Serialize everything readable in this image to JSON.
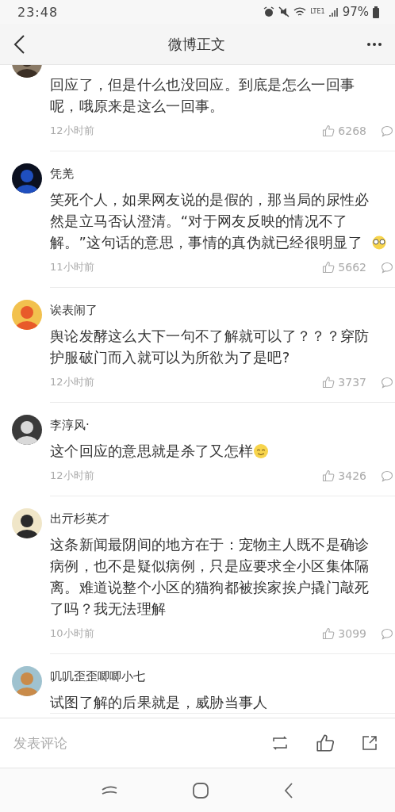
{
  "status_bar": {
    "time": "23:48",
    "network": "LTE1",
    "battery": "97%"
  },
  "header": {
    "title": "微博正文"
  },
  "comments": [
    {
      "text": "回应了，但是什么也没回应。到底是怎么一回事呢，哦原来是这么一回事。",
      "time": "12小时前",
      "likes": "6268"
    },
    {
      "author": "凭羌",
      "text": "笑死个人，如果网友说的是假的，那当局的尿性必然是立马否认澄清。“对于网友反映的情况不了解。”这句话的意思，事情的真伪就已经很明显了",
      "emoji": {
        "kind": "glasses"
      },
      "time": "11小时前",
      "likes": "5662"
    },
    {
      "author": "诶表闹了",
      "text": "舆论发酵这么大下一句不了解就可以了？？？穿防护服破门而入就可以为所欲为了是吧?",
      "time": "12小时前",
      "likes": "3737"
    },
    {
      "author": "李淳风·",
      "text": "这个回应的意思就是杀了又怎样",
      "emoji": {
        "kind": "smile"
      },
      "time": "12小时前",
      "likes": "3426"
    },
    {
      "author": "出亓杉英才",
      "text": "这条新闻最阴间的地方在于：宠物主人既不是确诊病例，也不是疑似病例，只是应要求全小区集体隔离。难道说整个小区的猫狗都被挨家挨户撬门敲死了吗？我无法理解",
      "time": "10小时前",
      "likes": "3099"
    },
    {
      "author": "叽叽歪歪唧唧小七",
      "text": "试图了解的后果就是，威胁当事人"
    }
  ],
  "compose": {
    "placeholder": "发表评论"
  }
}
